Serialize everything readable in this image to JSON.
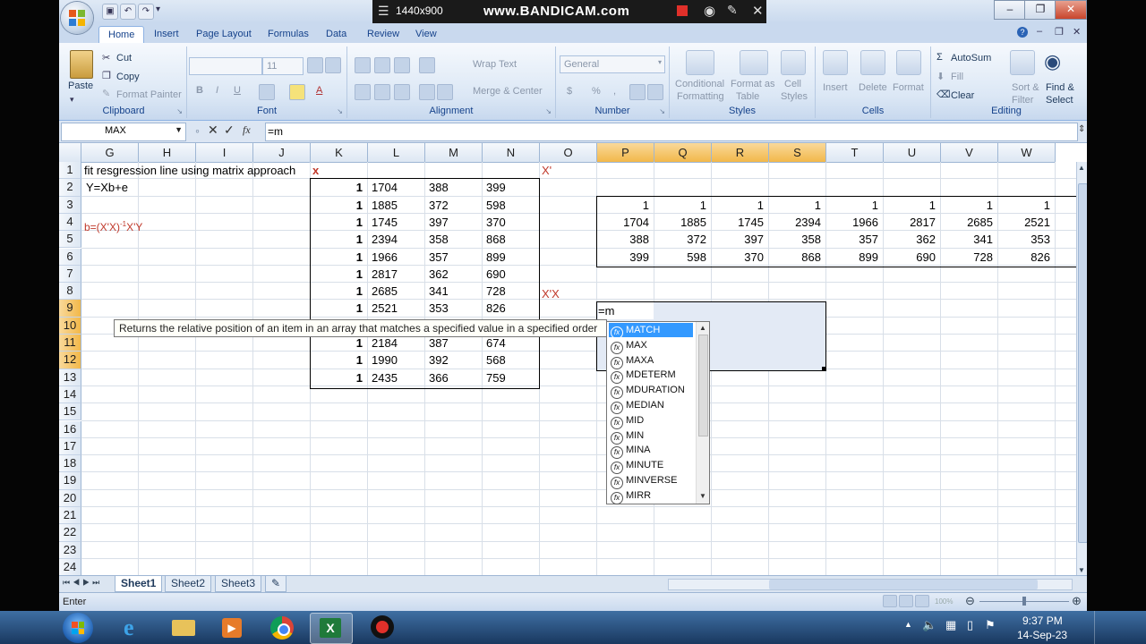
{
  "recorder": {
    "resolution": "1440x900",
    "brand": "www.BANDICAM.com"
  },
  "tabs": [
    "Home",
    "Insert",
    "Page Layout",
    "Formulas",
    "Data",
    "Review",
    "View"
  ],
  "ribbon": {
    "clipboard": {
      "paste": "Paste",
      "cut": "Cut",
      "copy": "Copy",
      "format_painter": "Format Painter",
      "label": "Clipboard"
    },
    "font": {
      "size": "11",
      "label": "Font"
    },
    "alignment": {
      "wrap": "Wrap Text",
      "merge": "Merge & Center",
      "label": "Alignment"
    },
    "number": {
      "format": "General",
      "percent": "%",
      "comma": ",",
      "label": "Number"
    },
    "styles": {
      "conditional": "Conditional",
      "conditional2": "Formatting",
      "format_as": "Format as",
      "format_as2": "Table",
      "cell": "Cell",
      "cell2": "Styles",
      "label": "Styles"
    },
    "cells": {
      "insert": "Insert",
      "delete": "Delete",
      "format": "Format",
      "label": "Cells"
    },
    "editing": {
      "autosum": "AutoSum",
      "fill": "Fill",
      "clear": "Clear",
      "sort": "Sort &",
      "sort2": "Filter",
      "find": "Find &",
      "find2": "Select",
      "label": "Editing"
    }
  },
  "formula_bar": {
    "name_box": "MAX",
    "fx": "fx",
    "content": "=m"
  },
  "columns": [
    "G",
    "H",
    "I",
    "J",
    "K",
    "L",
    "M",
    "N",
    "O",
    "P",
    "Q",
    "R",
    "S",
    "T",
    "U",
    "V",
    "W"
  ],
  "rows": [
    "1",
    "2",
    "3",
    "4",
    "5",
    "6",
    "7",
    "8",
    "9",
    "10",
    "11",
    "12",
    "13",
    "14",
    "15",
    "16",
    "17",
    "18",
    "19",
    "20",
    "21",
    "22",
    "23",
    "24"
  ],
  "cells": {
    "title": "fit resgression line using matrix approach",
    "model": "Y=Xb+e",
    "bformula_pre": "b=(X'X)",
    "bformula_sup": "-1",
    "bformula_post": "X'Y",
    "x_label": "x",
    "xt_label": "X'",
    "xtx_label": "X'X",
    "editing": "=m"
  },
  "x_matrix": [
    [
      "1",
      "1704",
      "388",
      "399"
    ],
    [
      "1",
      "1885",
      "372",
      "598"
    ],
    [
      "1",
      "1745",
      "397",
      "370"
    ],
    [
      "1",
      "2394",
      "358",
      "868"
    ],
    [
      "1",
      "1966",
      "357",
      "899"
    ],
    [
      "1",
      "2817",
      "362",
      "690"
    ],
    [
      "1",
      "2685",
      "341",
      "728"
    ],
    [
      "1",
      "2521",
      "353",
      "826"
    ],
    [
      "",
      "",
      "",
      ""
    ],
    [
      "1",
      "2184",
      "387",
      "674"
    ],
    [
      "1",
      "1990",
      "392",
      "568"
    ],
    [
      "1",
      "2435",
      "366",
      "759"
    ]
  ],
  "xt_matrix": [
    [
      "1",
      "1",
      "1",
      "1",
      "1",
      "1",
      "1",
      "1"
    ],
    [
      "1704",
      "1885",
      "1745",
      "2394",
      "1966",
      "2817",
      "2685",
      "2521"
    ],
    [
      "388",
      "372",
      "397",
      "358",
      "357",
      "362",
      "341",
      "353"
    ],
    [
      "399",
      "598",
      "370",
      "868",
      "899",
      "690",
      "728",
      "826"
    ]
  ],
  "tooltip": "Returns the relative position of an item in an array that matches a specified value in a specified order",
  "autocomplete": [
    "MATCH",
    "MAX",
    "MAXA",
    "MDETERM",
    "MDURATION",
    "MEDIAN",
    "MID",
    "MIN",
    "MINA",
    "MINUTE",
    "MINVERSE",
    "MIRR"
  ],
  "sheets": [
    "Sheet1",
    "Sheet2",
    "Sheet3"
  ],
  "status": {
    "mode": "Enter",
    "zoom": "100%"
  },
  "taskbar": {
    "time": "9:37 PM",
    "date": "14-Sep-23"
  }
}
